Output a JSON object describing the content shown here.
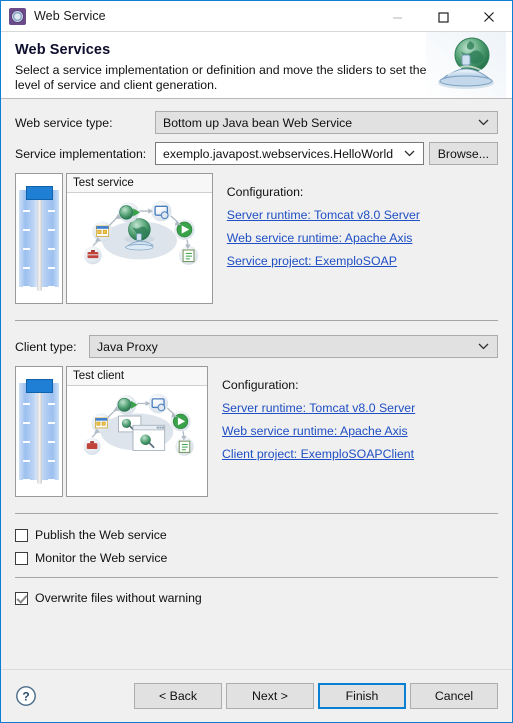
{
  "window": {
    "title": "Web Service",
    "icon": "gear-icon",
    "controls": {
      "minimize": "minimize-icon",
      "maximize": "maximize-icon",
      "close": "close-icon"
    }
  },
  "header": {
    "title": "Web Services",
    "description": "Select a service implementation or definition and move the sliders to set the level of service and client generation.",
    "graphic": "globe-on-dome-icon"
  },
  "form": {
    "web_service_type": {
      "label": "Web service type:",
      "value": "Bottom up Java bean Web Service"
    },
    "service_implementation": {
      "label": "Service implementation:",
      "value": "exemplo.javapost.webservices.HelloWorld",
      "browse_label": "Browse..."
    },
    "client_type": {
      "label": "Client type:",
      "value": "Java Proxy"
    }
  },
  "service_section": {
    "slider_name": "service-generation-slider",
    "preview_title": "Test service",
    "config_title": "Configuration:",
    "links": [
      "Server runtime: Tomcat v8.0 Server",
      "Web service runtime: Apache Axis",
      "Service project: ExemploSOAP"
    ]
  },
  "client_section": {
    "slider_name": "client-generation-slider",
    "preview_title": "Test client",
    "config_title": "Configuration:",
    "links": [
      "Server runtime: Tomcat v8.0 Server",
      "Web service runtime: Apache Axis",
      "Client project: ExemploSOAPClient"
    ]
  },
  "options": [
    {
      "label": "Publish the Web service",
      "checked": false,
      "name": "publish-web-service-checkbox"
    },
    {
      "label": "Monitor the Web service",
      "checked": false,
      "name": "monitor-web-service-checkbox"
    },
    {
      "label": "Overwrite files without warning",
      "checked": true,
      "name": "overwrite-files-checkbox"
    }
  ],
  "footer": {
    "help": "help-icon",
    "back": "< Back",
    "next": "Next >",
    "finish": "Finish",
    "cancel": "Cancel"
  },
  "colors": {
    "accent": "#0a7fd4",
    "link": "#1f4fc4",
    "slider_thumb": "#1e7fd4",
    "title_icon_bg": "#6b4b8a"
  }
}
